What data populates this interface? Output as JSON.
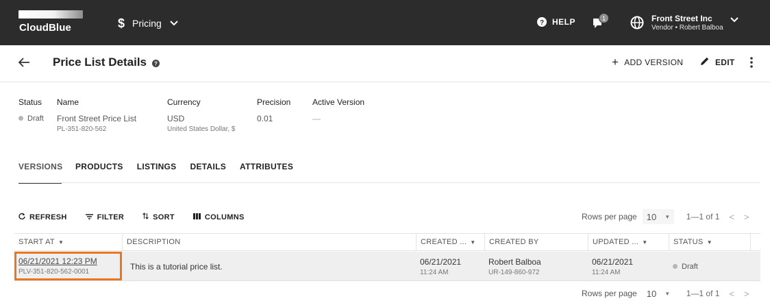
{
  "topbar": {
    "logo_text": "CloudBlue",
    "module_icon": "dollar-icon",
    "module_glyph": "$",
    "module_label": "Pricing",
    "help_label": "HELP",
    "notification_count": "1",
    "account_name": "Front Street Inc",
    "account_sub": "Vendor • Robert Balboa"
  },
  "header": {
    "title": "Price List Details",
    "add_version_label": "ADD VERSION",
    "edit_label": "EDIT"
  },
  "details": {
    "status_label": "Status",
    "status_value": "Draft",
    "name_label": "Name",
    "name_value": "Front Street Price List",
    "name_id": "PL-351-820-562",
    "currency_label": "Currency",
    "currency_value": "USD",
    "currency_sub": "United States Dollar, $",
    "precision_label": "Precision",
    "precision_value": "0.01",
    "active_version_label": "Active Version",
    "active_version_value": "—"
  },
  "tabs": [
    "VERSIONS",
    "PRODUCTS",
    "LISTINGS",
    "DETAILS",
    "ATTRIBUTES"
  ],
  "active_tab": "VERSIONS",
  "toolbar": {
    "refresh_label": "REFRESH",
    "filter_label": "FILTER",
    "sort_label": "SORT",
    "columns_label": "COLUMNS"
  },
  "pagination": {
    "rows_per_page_label": "Rows per page",
    "rows_per_page_value": "10",
    "range": "1—1 of 1",
    "prev": "<",
    "next": ">"
  },
  "table": {
    "columns": [
      "START AT",
      "DESCRIPTION",
      "CREATED ...",
      "CREATED BY",
      "UPDATED ...",
      "STATUS"
    ],
    "rows": [
      {
        "start_at": "06/21/2021 12:23 PM",
        "start_id": "PLV-351-820-562-0001",
        "description": "This is a tutorial price list.",
        "created_date": "06/21/2021",
        "created_time": "11:24 AM",
        "created_by": "Robert Balboa",
        "created_by_id": "UR-149-860-972",
        "updated_date": "06/21/2021",
        "updated_time": "11:24 AM",
        "status": "Draft"
      }
    ]
  },
  "colors": {
    "topbar": "#2c2c2c",
    "highlight": "#e87722",
    "row_bg": "#efefef",
    "draft_dot": "#b5b5b5"
  }
}
